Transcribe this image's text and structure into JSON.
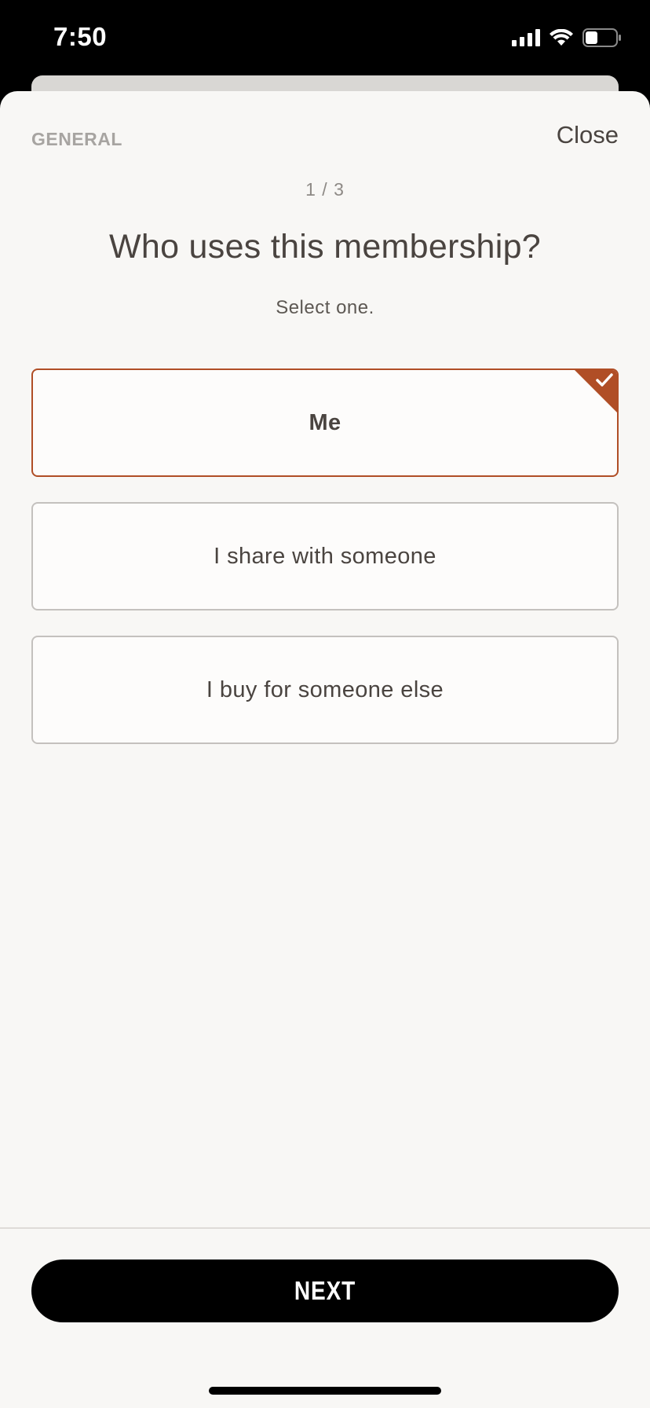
{
  "status_bar": {
    "time": "7:50",
    "icons": [
      "signal-icon",
      "wifi-icon",
      "battery-icon"
    ]
  },
  "header": {
    "section": "GENERAL",
    "close_label": "Close"
  },
  "question": {
    "step": "1 / 3",
    "title": "Who uses this membership?",
    "instruction": "Select one."
  },
  "options": [
    {
      "label": "Me",
      "selected": true
    },
    {
      "label": "I share with someone",
      "selected": false
    },
    {
      "label": "I buy for someone else",
      "selected": false
    }
  ],
  "footer": {
    "next_label": "NEXT"
  },
  "colors": {
    "accent": "#b04e26",
    "background": "#f8f7f5",
    "text": "#4a4440",
    "button": "#000000"
  }
}
